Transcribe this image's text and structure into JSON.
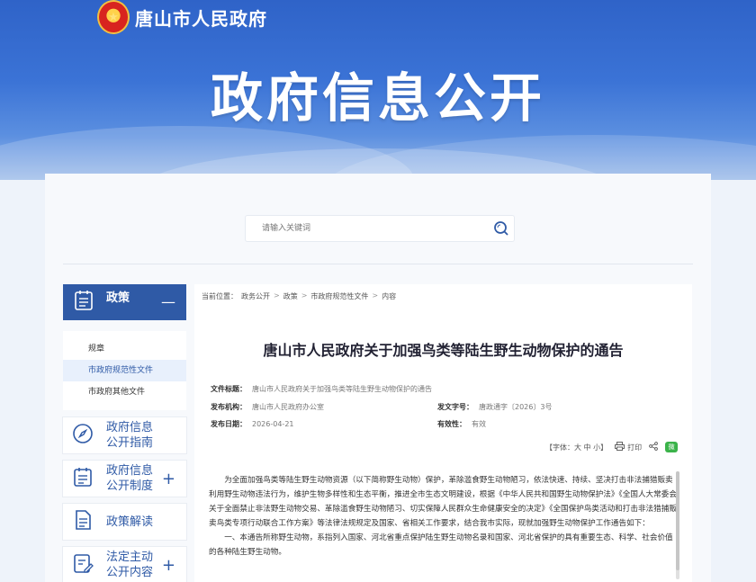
{
  "header": {
    "site_name": "唐山市人民政府",
    "banner_title": "政府信息公开"
  },
  "search": {
    "placeholder": "请输入关键词"
  },
  "sidebar": {
    "section": {
      "label": "政策",
      "toggle": "—"
    },
    "sub_items": [
      {
        "label": "规章"
      },
      {
        "label": "市政府规范性文件"
      },
      {
        "label": "市政府其他文件"
      }
    ],
    "cards": [
      {
        "label": "政府信息公开指南",
        "toggle": ""
      },
      {
        "label": "政府信息公开制度",
        "toggle": "+"
      },
      {
        "label": "政策解读",
        "toggle": ""
      },
      {
        "label": "法定主动公开内容",
        "toggle": "+"
      }
    ]
  },
  "breadcrumb": {
    "prefix": "当前位置：",
    "items": [
      "政务公开",
      "政策",
      "市政府规范性文件",
      "内容"
    ],
    "sep": ">"
  },
  "article": {
    "title": "唐山市人民政府关于加强鸟类等陆生野生动物保护的通告",
    "meta": {
      "file_title_label": "文件标题：",
      "file_title": "唐山市人民政府关于加强鸟类等陆生野生动物保护的通告",
      "issuer_label": "发布机构：",
      "issuer": "唐山市人民政府办公室",
      "doc_no_label": "发文字号：",
      "doc_no": "唐政通字〔2026〕3号",
      "date_label": "发布日期：",
      "date": "2026-04-21",
      "validity_label": "有效性：",
      "validity": "有效"
    },
    "tools": {
      "font_size": "【字体：大 中 小】",
      "print": "打印",
      "wechat": "微"
    },
    "paragraphs": [
      "为全面加强鸟类等陆生野生动物资源（以下简称野生动物）保护，革除滥食野生动物陋习，依法快速、持续、坚决打击非法捕猎贩卖利用野生动物违法行为，维护生物多样性和生态平衡，推进全市生态文明建设，根据《中华人民共和国野生动物保护法》《全国人大常委会关于全面禁止非法野生动物交易、革除滥食野生动物陋习、切实保障人民群众生命健康安全的决定》《全国保护鸟类活动和打击非法猎捕贩卖鸟类专项行动联合工作方案》等法律法规规定及国家、省相关工作要求，结合我市实际，现就加强野生动物保护工作通告如下：",
      "一、本通告所称野生动物，系指列入国家、河北省重点保护陆生野生动物名录和国家、河北省保护的具有重要生态、科学、社会价值的各种陆生野生动物。"
    ]
  }
}
